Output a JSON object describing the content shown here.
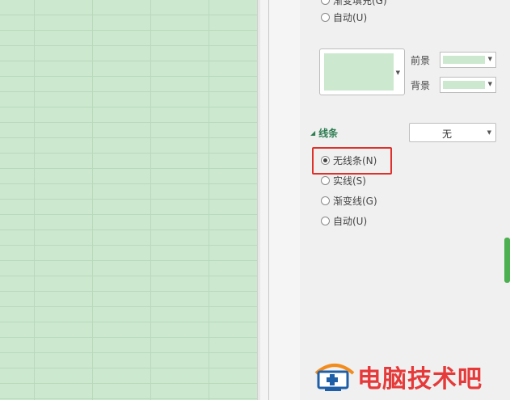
{
  "fill": {
    "partial_option_label": "渐变填充(G)",
    "auto_option_label": "自动(U)",
    "foreground_label": "前景",
    "background_label": "背景",
    "pattern_color": "#cce8cf"
  },
  "line": {
    "section_title": "线条",
    "dropdown_value": "无",
    "options": [
      {
        "label": "无线条(N)",
        "checked": true
      },
      {
        "label": "实线(S)",
        "checked": false
      },
      {
        "label": "渐变线(G)",
        "checked": false
      },
      {
        "label": "自动(U)",
        "checked": false
      }
    ]
  },
  "watermark": {
    "text": "电脑技术吧",
    "color": "#e63a3a"
  },
  "colors": {
    "sheet_background": "#cce8cf",
    "section_accent": "#2e7d52",
    "highlight_border": "#e0302b",
    "scrollbar": "#4caf50"
  }
}
